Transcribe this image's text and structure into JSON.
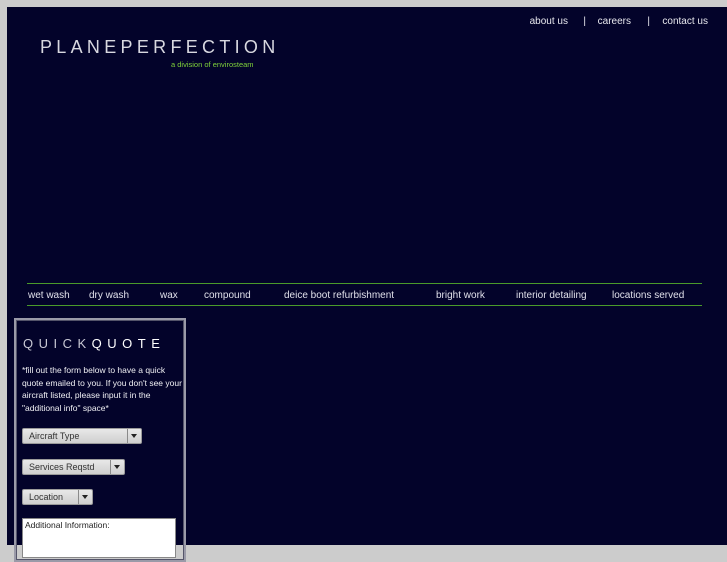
{
  "topnav": {
    "items": [
      "about us",
      "careers",
      "contact us"
    ],
    "separator": "|"
  },
  "brand": {
    "logo": "PLANEPERFECTION",
    "tagline": "a division of envirosteam",
    "tagline_color": "#7fd23a",
    "background_color": "#03032a",
    "rule_color": "#4a9a2a"
  },
  "menu": {
    "items": [
      "wet wash",
      "dry wash",
      "wax",
      "compound",
      "deice boot refurbishment",
      "bright work",
      "interior detailing",
      "locations served"
    ]
  },
  "quickquote": {
    "title_light": "QUICK",
    "title_bold": "QUOTE",
    "description": "*fill out the form below to have a quick quote emailed to you. If you don't see your aircraft listed, please input it in the \"additional info\" space*",
    "selects": [
      {
        "label": "Aircraft Type"
      },
      {
        "label": "Services Reqstd"
      },
      {
        "label": "Location"
      }
    ],
    "additional_info_placeholder": "Additional Information:"
  }
}
